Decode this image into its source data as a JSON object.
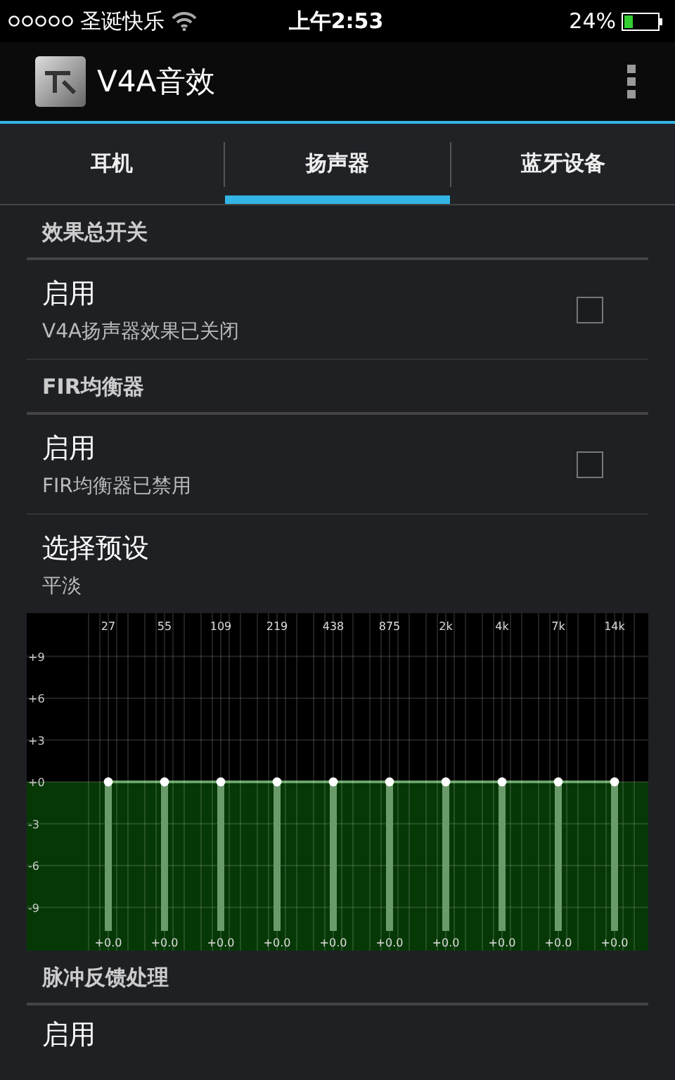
{
  "status_bar": {
    "carrier": "圣诞快乐",
    "time": "上午2:53",
    "battery": "24%"
  },
  "app_bar": {
    "title": "V4A音效"
  },
  "tabs": [
    {
      "label": "耳机",
      "selected": false
    },
    {
      "label": "扬声器",
      "selected": true
    },
    {
      "label": "蓝牙设备",
      "selected": false
    }
  ],
  "items": [
    {
      "kind": "header",
      "title": "效果总开关"
    },
    {
      "kind": "toggle",
      "title": "启用",
      "summary": "V4A扬声器效果已关闭",
      "checked": false
    },
    {
      "kind": "header",
      "title": "FIR均衡器"
    },
    {
      "kind": "toggle",
      "title": "启用",
      "summary": "FIR均衡器已禁用",
      "checked": false
    },
    {
      "kind": "preset",
      "title": "选择预设",
      "summary": "平淡"
    },
    {
      "kind": "equalizer",
      "chart_data": {
        "type": "line",
        "categories": [
          "27",
          "55",
          "109",
          "219",
          "438",
          "875",
          "2k",
          "4k",
          "7k",
          "14k"
        ],
        "grid": true,
        "series": [
          {
            "color": "#ffffff",
            "marker": "o",
            "values": [
              0,
              0,
              0,
              0,
              0,
              0,
              0,
              0,
              0,
              0
            ]
          }
        ],
        "ylim": [
          -12,
          12
        ],
        "yticks": [
          {
            "value": 9,
            "label": "+9"
          },
          {
            "value": 6,
            "label": "+6"
          },
          {
            "value": 3,
            "label": "+3"
          },
          {
            "value": 0,
            "label": "+0"
          },
          {
            "value": -3,
            "label": "-3"
          },
          {
            "value": -6,
            "label": "-6"
          },
          {
            "value": -9,
            "label": "-9"
          }
        ],
        "value_labels": [
          "+0.0",
          "+0.0",
          "+0.0",
          "+0.0",
          "+0.0",
          "+0.0",
          "+0.0",
          "+0.0",
          "+0.0",
          "+0.0"
        ]
      }
    },
    {
      "kind": "header",
      "title": "脉冲反馈处理"
    },
    {
      "kind": "plain",
      "title": "启用"
    }
  ]
}
